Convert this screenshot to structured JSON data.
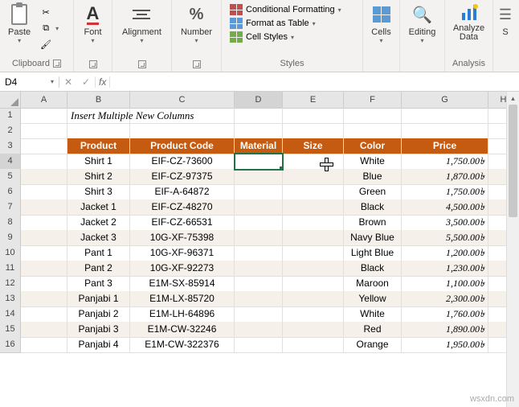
{
  "ribbon": {
    "clipboard": {
      "label": "Clipboard",
      "paste": "Paste"
    },
    "font": {
      "label": "Font",
      "btn": "Font"
    },
    "alignment": {
      "label": "Alignment",
      "btn": "Alignment"
    },
    "number": {
      "label": "Number",
      "btn": "Number"
    },
    "styles": {
      "label": "Styles",
      "cond": "Conditional Formatting",
      "table": "Format as Table",
      "cellstyles": "Cell Styles"
    },
    "cells": {
      "label": "Cells",
      "btn": "Cells"
    },
    "editing": {
      "label": "Editing",
      "btn": "Editing"
    },
    "analysis": {
      "label": "Analysis",
      "btn": "Analyze Data"
    },
    "s": "S"
  },
  "namebox": "D4",
  "columns": [
    "A",
    "B",
    "C",
    "D",
    "E",
    "F",
    "G",
    "H"
  ],
  "title_text": "Insert Multiple New Columns",
  "headers": {
    "product": "Product",
    "code": "Product Code",
    "material": "Material",
    "size": "Size",
    "color": "Color",
    "price": "Price"
  },
  "rows": [
    {
      "product": "Shirt 1",
      "code": "EIF-CZ-73600",
      "color": "White",
      "price": "1,750.00৳"
    },
    {
      "product": "Shirt 2",
      "code": "EIF-CZ-97375",
      "color": "Blue",
      "price": "1,870.00৳"
    },
    {
      "product": "Shirt 3",
      "code": "EIF-A-64872",
      "color": "Green",
      "price": "1,750.00৳"
    },
    {
      "product": "Jacket 1",
      "code": "EIF-CZ-48270",
      "color": "Black",
      "price": "4,500.00৳"
    },
    {
      "product": "Jacket 2",
      "code": "EIF-CZ-66531",
      "color": "Brown",
      "price": "3,500.00৳"
    },
    {
      "product": "Jacket 3",
      "code": "10G-XF-75398",
      "color": "Navy Blue",
      "price": "5,500.00৳"
    },
    {
      "product": "Pant 1",
      "code": "10G-XF-96371",
      "color": "Light Blue",
      "price": "1,200.00৳"
    },
    {
      "product": "Pant 2",
      "code": "10G-XF-92273",
      "color": "Black",
      "price": "1,230.00৳"
    },
    {
      "product": "Pant 3",
      "code": "E1M-SX-85914",
      "color": "Maroon",
      "price": "1,100.00৳"
    },
    {
      "product": "Panjabi 1",
      "code": "E1M-LX-85720",
      "color": "Yellow",
      "price": "2,300.00৳"
    },
    {
      "product": "Panjabi 2",
      "code": "E1M-LH-64896",
      "color": "White",
      "price": "1,760.00৳"
    },
    {
      "product": "Panjabi 3",
      "code": "E1M-CW-32246",
      "color": "Red",
      "price": "1,890.00৳"
    },
    {
      "product": "Panjabi 4",
      "code": "E1M-CW-322376",
      "color": "Orange",
      "price": "1,950.00৳"
    }
  ],
  "watermark": "wsxdn.com"
}
